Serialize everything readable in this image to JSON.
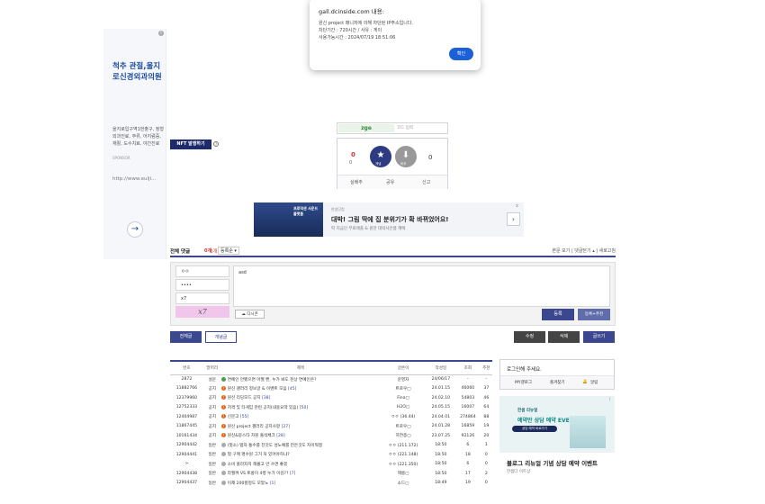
{
  "left_ad": {
    "title": "척추 관절,울지로신경외과의원",
    "desc": "을지로입구역1번출구, 정형외과진료, 주류, 어지럼증, 재활, 도수치료, 야간진료",
    "sponsor": "SPONSOR",
    "url": "http://www.eulji...",
    "info_icon": "i",
    "arrow": "→"
  },
  "alert": {
    "header": "gall.dcinside.com 내용:",
    "lines": [
      "원신 project 매니저에 의해 차단된 IP주소입니다.",
      "차단기간 : 720시간 / 사유 : 게이",
      "사용가능시간 : 2024/07/19 18:51:06"
    ],
    "ok_label": "확인"
  },
  "nft": {
    "label": "NFT 발행하기",
    "help": "?"
  },
  "vote": {
    "code_text": "zge",
    "code_placeholder": "코드 입력",
    "up_count": "0",
    "fixed_count": "0",
    "up_label": "개념",
    "down_label": "비추",
    "down_count": "0",
    "realtime": "실베추",
    "share": "공유",
    "report": "신고"
  },
  "mid_ad": {
    "image_text": "프로덕센 사운드 플랫폼",
    "source": "한셈닷컴",
    "headline": "대박! 그림 딱에 집 분위기가 확 바뀌었어요!",
    "sub": "딱 지금인 무료애플 & 원한 대박사은품 혜택",
    "go": "›",
    "close": "x"
  },
  "comments": {
    "all_label": "전체 댓글",
    "count": "0개",
    "sort": "등록순 ▾",
    "right_links": "본문 보기  |  댓글닫기 ▴  |  새로고침",
    "nick_value": "ㅇㅇ",
    "password_value": "••••",
    "captcha_input": "x7",
    "captcha_image": "x7",
    "textarea_value": "asd",
    "dccon_label": "디시콘",
    "submit_label": "등록",
    "submit_rec_label": "등록+추천"
  },
  "list_buttons": {
    "all": "전체글",
    "concept": "개념글",
    "mode": "수정",
    "delete": "삭제",
    "write": "글쓰기"
  },
  "table": {
    "headers": [
      "번호",
      "말머리",
      "제목",
      "글쓴이",
      "작성일",
      "조회",
      "추천"
    ],
    "rows": [
      {
        "no": "2872",
        "head": "설문",
        "icon": "g",
        "title": "연예인 안됐으면 어쩔 뻔, 누가 봐도 천상 연예인은?",
        "cmt": "",
        "writer": "운영자",
        "date": "24/06/17",
        "view": "-",
        "rec": "-"
      },
      {
        "no": "11882766",
        "head": "공지",
        "icon": "o",
        "title": "원신 갤러리 정보글 & 이벤트 모음",
        "cmt": "[45]",
        "writer": "트로우▢",
        "date": "24.01.15",
        "view": "46060",
        "rec": "37"
      },
      {
        "no": "12379960",
        "head": "공지",
        "icon": "o",
        "title": "원신 리딩모드 공지",
        "cmt": "[38]",
        "writer": "Fina▢",
        "date": "24.02.10",
        "view": "54803",
        "rec": "46"
      },
      {
        "no": "12752333",
        "head": "공지",
        "icon": "o",
        "title": "저격 및 타게임 관련 공지(내용요약 있음)",
        "cmt": "[50]",
        "writer": "H2O▢",
        "date": "24.05.15",
        "view": "16007",
        "rec": "64"
      },
      {
        "no": "12404987",
        "head": "공지",
        "icon": "o",
        "title": "신문고",
        "cmt": "[55]",
        "writer": "ㅇㅇ (36.44)",
        "date": "24.04.01",
        "view": "274864",
        "rec": "88"
      },
      {
        "no": "11867445",
        "head": "공지",
        "icon": "o",
        "title": "원신 project 갤러리 공지사항",
        "cmt": "[27]",
        "writer": "트로우▢",
        "date": "24.01.28",
        "view": "16859",
        "rec": "19"
      },
      {
        "no": "10161434",
        "head": "공지",
        "icon": "o",
        "title": "원신&붕스타 차원 출석체크",
        "cmt": "[28]",
        "writer": "하얀종▢",
        "date": "23.07.25",
        "view": "92126",
        "rec": "20"
      },
      {
        "no": "12904442",
        "head": "일반",
        "icon": "gray",
        "title": "(헛소) 탭자 통수를 친것도 성노예를 만든것도 차이찍찡",
        "cmt": "",
        "writer": "ㅇㅇ (211.172)",
        "date": "18:50",
        "view": "6",
        "rec": "1"
      },
      {
        "no": "12904441",
        "head": "일반",
        "icon": "gray",
        "title": "헛 구매 명수원 그거 처 있어야하냐?",
        "cmt": "",
        "writer": "ㅇㅇ (221.148)",
        "date": "18:50",
        "view": "18",
        "rec": "0"
      },
      {
        "no": ">",
        "head": "일반",
        "icon": "gray",
        "title": "소비 폴라자치 해볼고 안 쓰면 좋겠",
        "cmt": "",
        "writer": "ㅇㅇ (221.350)",
        "date": "18:50",
        "view": "6",
        "rec": "0"
      },
      {
        "no": "12904438",
        "head": "일반",
        "icon": "gray",
        "title": "라월켜 VS 토롱이 4병 누가 이김??",
        "cmt": "[7]",
        "writer": "헤롱▢",
        "date": "18:50",
        "view": "17",
        "rec": "2"
      },
      {
        "no": "12904437",
        "head": "일반",
        "icon": "gray",
        "title": "이제 200할정도 모았노",
        "cmt": "[1]",
        "writer": "소드▢",
        "date": "18:49",
        "view": "19",
        "rec": "0"
      }
    ]
  },
  "login": {
    "message": "로그인해 주세요.",
    "tab1": "MY갤로그",
    "tab2": "즐겨찾기",
    "tab3": "알림"
  },
  "right_ad": {
    "head": "한샘 리뉴얼",
    "event": "예약만 상담 예약 EVENT",
    "pill": "상담 예약 바로가기",
    "info": "i",
    "title": "블로그 리뉴얼 기념 상담 예약 이벤트",
    "advertiser": "한샘다 이트상"
  }
}
